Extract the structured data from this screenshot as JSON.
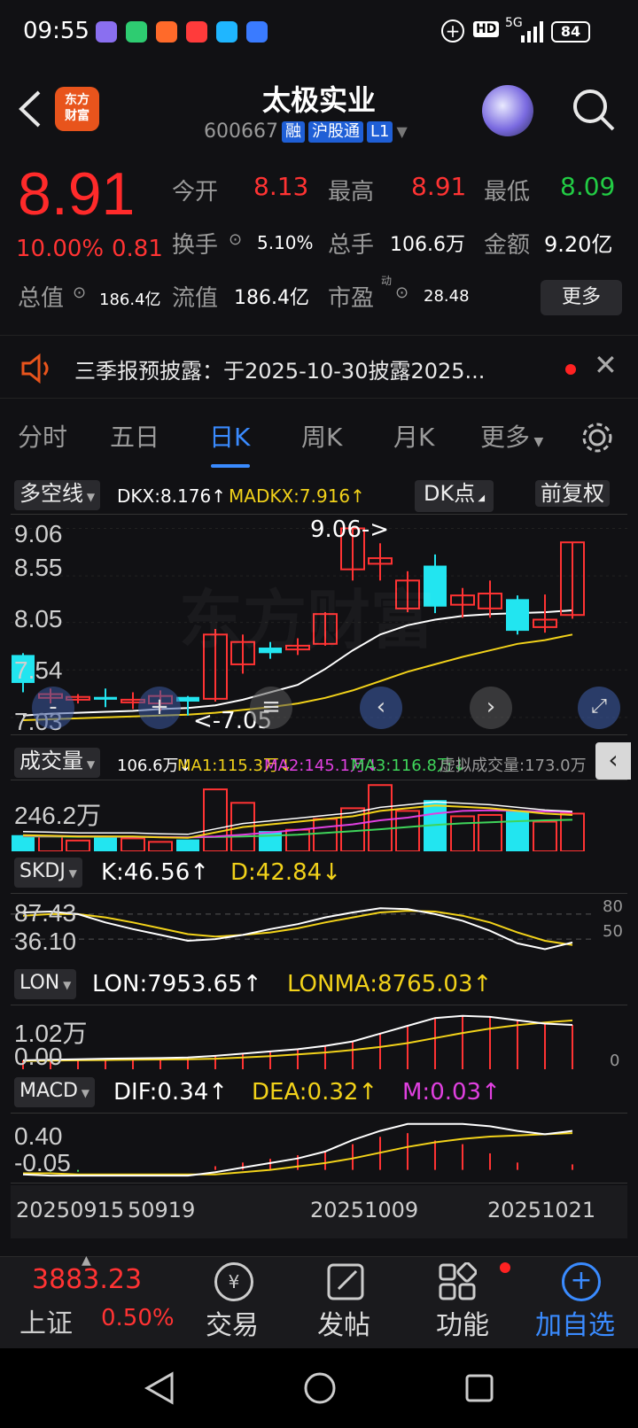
{
  "status_bar": {
    "time": "09:55",
    "hd": "HD",
    "net": "5G",
    "battery": "84"
  },
  "header": {
    "logo_line1": "东方",
    "logo_line2": "财富",
    "stock_name": "太极实业",
    "stock_code": "600667",
    "tag_rong": "融",
    "tag_hgt": "沪股通",
    "tag_l1": "L1"
  },
  "quote": {
    "price": "8.91",
    "change_pct": "10.00%",
    "change": "0.81",
    "open_label": "今开",
    "open": "8.13",
    "high_label": "最高",
    "high": "8.91",
    "low_label": "最低",
    "low": "8.09",
    "turnover_label": "换手",
    "turnover": "5.10%",
    "volume_label": "总手",
    "volume": "106.6万",
    "amount_label": "金额",
    "amount": "9.20亿",
    "mcap_label": "总值",
    "mcap": "186.4亿",
    "float_label": "流值",
    "float": "186.4亿",
    "pe_label": "市盈",
    "pe_sup": "动",
    "pe": "28.48",
    "more": "更多"
  },
  "notice": {
    "text": "三季报预披露：于2025-10-30披露2025..."
  },
  "tabs": [
    "分时",
    "五日",
    "日K",
    "周K",
    "月K",
    "更多"
  ],
  "kline_header": {
    "selector": "多空线",
    "dkx": "DKX:8.176↑",
    "madkx": "MADKX:7.916↑",
    "dk_point": "DK点",
    "adjust": "前复权"
  },
  "kline_axis": [
    "9.06",
    "8.55",
    "8.05",
    "7.54",
    "7.03"
  ],
  "kline_notes": {
    "high": "9.06->",
    "low": "<-7.05"
  },
  "vol_header": {
    "selector": "成交量",
    "vol": "106.6万↓",
    "ma1": "MA1:115.3万↓",
    "ma2": "MA2:145.1万↓",
    "ma3": "MA3:116.8万↓",
    "virtual": "虚拟成交量:173.0万"
  },
  "vol_axis": "246.2万",
  "skdj_header": {
    "selector": "SKDJ",
    "k": "K:46.56↑",
    "d": "D:42.84↓"
  },
  "skdj_axis": {
    "top": "87.43",
    "bottom": "36.10",
    "r80": "80",
    "r50": "50"
  },
  "lon_header": {
    "selector": "LON",
    "lon": "LON:7953.65↑",
    "lonma": "LONMA:8765.03↑"
  },
  "lon_axis": {
    "top": "1.02万",
    "bottom": "0.00",
    "r0": "0"
  },
  "macd_header": {
    "selector": "MACD",
    "dif": "DIF:0.34↑",
    "dea": "DEA:0.32↑",
    "m": "M:0.03↑"
  },
  "macd_axis": {
    "top": "0.40",
    "bottom": "-0.05"
  },
  "date_axis": [
    "20250915",
    "50919",
    "20251009",
    "20251021"
  ],
  "bottom_nav": {
    "index_value": "3883.23",
    "index_name": "上证",
    "index_pct": "0.50%",
    "trade": "交易",
    "post": "发帖",
    "func": "功能",
    "add": "加自选"
  },
  "chart_data": {
    "type": "candlestick",
    "candles": [
      {
        "o": 7.4,
        "c": 7.7,
        "h": 7.72,
        "l": 7.3,
        "dir": "up"
      },
      {
        "o": 7.28,
        "c": 7.24,
        "h": 7.34,
        "l": 7.18,
        "dir": "down"
      },
      {
        "o": 7.25,
        "c": 7.22,
        "h": 7.28,
        "l": 7.18,
        "dir": "down"
      },
      {
        "o": 7.22,
        "c": 7.25,
        "h": 7.34,
        "l": 7.14,
        "dir": "up"
      },
      {
        "o": 7.22,
        "c": 7.22,
        "h": 7.3,
        "l": 7.12,
        "dir": "down"
      },
      {
        "o": 7.26,
        "c": 7.18,
        "h": 7.32,
        "l": 7.1,
        "dir": "down"
      },
      {
        "o": 7.25,
        "c": 7.2,
        "h": 7.26,
        "l": 7.05,
        "dir": "up"
      },
      {
        "o": 7.23,
        "c": 7.92,
        "h": 7.98,
        "l": 7.2,
        "dir": "down"
      },
      {
        "o": 7.6,
        "c": 7.84,
        "h": 7.92,
        "l": 7.5,
        "dir": "down"
      },
      {
        "o": 7.78,
        "c": 7.72,
        "h": 7.84,
        "l": 7.66,
        "dir": "up"
      },
      {
        "o": 7.76,
        "c": 7.8,
        "h": 7.88,
        "l": 7.7,
        "dir": "down"
      },
      {
        "o": 7.82,
        "c": 8.14,
        "h": 8.16,
        "l": 7.8,
        "dir": "down"
      },
      {
        "o": 8.62,
        "c": 9.06,
        "h": 9.06,
        "l": 8.5,
        "dir": "down"
      },
      {
        "o": 8.74,
        "c": 8.68,
        "h": 8.9,
        "l": 8.5,
        "dir": "down"
      },
      {
        "o": 8.2,
        "c": 8.5,
        "h": 8.6,
        "l": 8.16,
        "dir": "down"
      },
      {
        "o": 8.66,
        "c": 8.22,
        "h": 8.78,
        "l": 8.15,
        "dir": "up"
      },
      {
        "o": 8.34,
        "c": 8.24,
        "h": 8.42,
        "l": 8.1,
        "dir": "down"
      },
      {
        "o": 8.2,
        "c": 8.36,
        "h": 8.5,
        "l": 8.1,
        "dir": "down"
      },
      {
        "o": 8.3,
        "c": 7.96,
        "h": 8.34,
        "l": 7.92,
        "dir": "up"
      },
      {
        "o": 8.0,
        "c": 8.08,
        "h": 8.35,
        "l": 7.94,
        "dir": "down"
      },
      {
        "o": 8.13,
        "c": 8.91,
        "h": 8.91,
        "l": 8.09,
        "dir": "down"
      }
    ],
    "dkx": [
      7.05,
      7.07,
      7.08,
      7.09,
      7.1,
      7.12,
      7.13,
      7.16,
      7.22,
      7.3,
      7.38,
      7.55,
      7.75,
      7.92,
      8.02,
      8.08,
      8.12,
      8.14,
      8.15,
      8.16,
      8.18
    ],
    "madkx": [
      7.0,
      7.01,
      7.02,
      7.03,
      7.04,
      7.05,
      7.06,
      7.08,
      7.11,
      7.14,
      7.18,
      7.24,
      7.32,
      7.42,
      7.52,
      7.6,
      7.68,
      7.75,
      7.82,
      7.86,
      7.92
    ],
    "volume": [
      60,
      55,
      40,
      52,
      48,
      35,
      44,
      230,
      180,
      75,
      80,
      120,
      160,
      246,
      150,
      190,
      130,
      135,
      150,
      110,
      140
    ],
    "ma1": [
      60,
      58,
      55,
      55,
      55,
      52,
      50,
      70,
      90,
      100,
      110,
      120,
      130,
      150,
      160,
      170,
      165,
      160,
      150,
      140,
      135
    ],
    "ma2": [
      58,
      57,
      56,
      55,
      54,
      53,
      52,
      55,
      62,
      70,
      80,
      90,
      100,
      115,
      125,
      140,
      150,
      152,
      150,
      148,
      145
    ],
    "ma3": [
      55,
      55,
      54,
      54,
      54,
      53,
      52,
      53,
      55,
      58,
      62,
      68,
      75,
      82,
      90,
      98,
      104,
      108,
      112,
      115,
      117
    ],
    "skdj_k": [
      82,
      83,
      80,
      70,
      62,
      55,
      48,
      50,
      55,
      62,
      68,
      76,
      82,
      87,
      86,
      80,
      72,
      60,
      45,
      38,
      46
    ],
    "skdj_d": [
      78,
      80,
      80,
      76,
      70,
      63,
      56,
      53,
      55,
      58,
      63,
      70,
      76,
      82,
      84,
      83,
      78,
      70,
      58,
      48,
      43
    ],
    "lon": [
      1600,
      1700,
      1800,
      1900,
      1950,
      2000,
      2100,
      2400,
      2800,
      3200,
      3600,
      4200,
      5000,
      6400,
      7800,
      9200,
      9600,
      9400,
      8800,
      8200,
      7953
    ],
    "lonma": [
      1500,
      1550,
      1600,
      1650,
      1700,
      1750,
      1800,
      1900,
      2100,
      2350,
      2650,
      3000,
      3450,
      4000,
      4700,
      5600,
      6500,
      7300,
      7900,
      8400,
      8765
    ],
    "macd_dif": [
      -0.04,
      -0.05,
      -0.05,
      -0.05,
      -0.05,
      -0.05,
      -0.05,
      -0.02,
      0.02,
      0.06,
      0.1,
      0.16,
      0.26,
      0.34,
      0.4,
      0.4,
      0.4,
      0.38,
      0.34,
      0.31,
      0.34
    ],
    "macd_dea": [
      -0.03,
      -0.03,
      -0.04,
      -0.04,
      -0.04,
      -0.04,
      -0.04,
      -0.04,
      -0.02,
      0.0,
      0.03,
      0.06,
      0.1,
      0.15,
      0.2,
      0.24,
      0.27,
      0.29,
      0.3,
      0.31,
      0.32
    ],
    "macd_m": [
      0.0,
      -0.01,
      -0.01,
      0.0,
      0.0,
      0.0,
      0.0,
      0.02,
      0.04,
      0.06,
      0.08,
      0.1,
      0.14,
      0.18,
      0.2,
      0.16,
      0.14,
      0.09,
      0.04,
      0.0,
      0.03
    ],
    "colors": {
      "up": "#ff3333",
      "down": "#22e5f0",
      "dkx": "#ffffff",
      "madkx": "#f2d21a",
      "ma2": "#e040e0",
      "ma3": "#3fd45a"
    }
  }
}
